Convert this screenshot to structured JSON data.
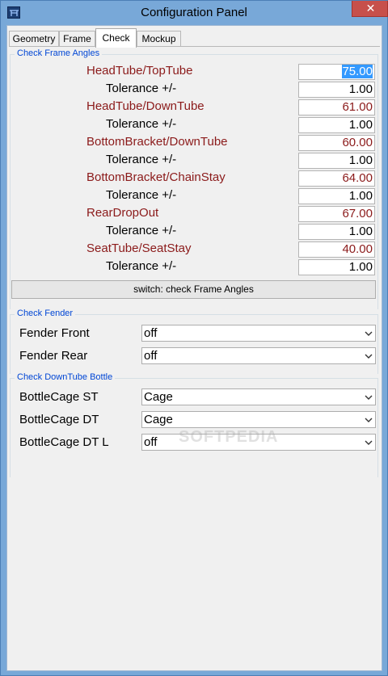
{
  "window": {
    "title": "Configuration Panel",
    "close_glyph": "✕",
    "colors": {
      "frame": "#78a8d8",
      "close": "#c7504b",
      "group_title": "#0046d5",
      "angle_label": "#8b1a1a"
    }
  },
  "tabs": [
    {
      "label": "Geometry",
      "active": false
    },
    {
      "label": "Frame",
      "active": false
    },
    {
      "label": "Check",
      "active": true
    },
    {
      "label": "Mockup",
      "active": false
    }
  ],
  "frame_angles": {
    "group_title": "Check Frame Angles",
    "tolerance_label": "Tolerance +/-",
    "rows": [
      {
        "label": "HeadTube/TopTube",
        "value": "75.00",
        "tolerance": "1.00"
      },
      {
        "label": "HeadTube/DownTube",
        "value": "61.00",
        "tolerance": "1.00"
      },
      {
        "label": "BottomBracket/DownTube",
        "value": "60.00",
        "tolerance": "1.00"
      },
      {
        "label": "BottomBracket/ChainStay",
        "value": "64.00",
        "tolerance": "1.00"
      },
      {
        "label": "RearDropOut",
        "value": "67.00",
        "tolerance": "1.00"
      },
      {
        "label": "SeatTube/SeatStay",
        "value": "40.00",
        "tolerance": "1.00"
      }
    ],
    "switch_button": "switch: check Frame Angles"
  },
  "fender": {
    "group_title": "Check Fender",
    "rows": [
      {
        "label": "Fender Front",
        "value": "off"
      },
      {
        "label": "Fender Rear",
        "value": "off"
      }
    ]
  },
  "bottle": {
    "group_title": "Check DownTube Bottle",
    "rows": [
      {
        "label": "BottleCage ST",
        "value": "Cage"
      },
      {
        "label": "BottleCage DT",
        "value": "Cage"
      },
      {
        "label": "BottleCage DT L",
        "value": "off"
      }
    ]
  },
  "watermark": "SOFTPEDIA"
}
